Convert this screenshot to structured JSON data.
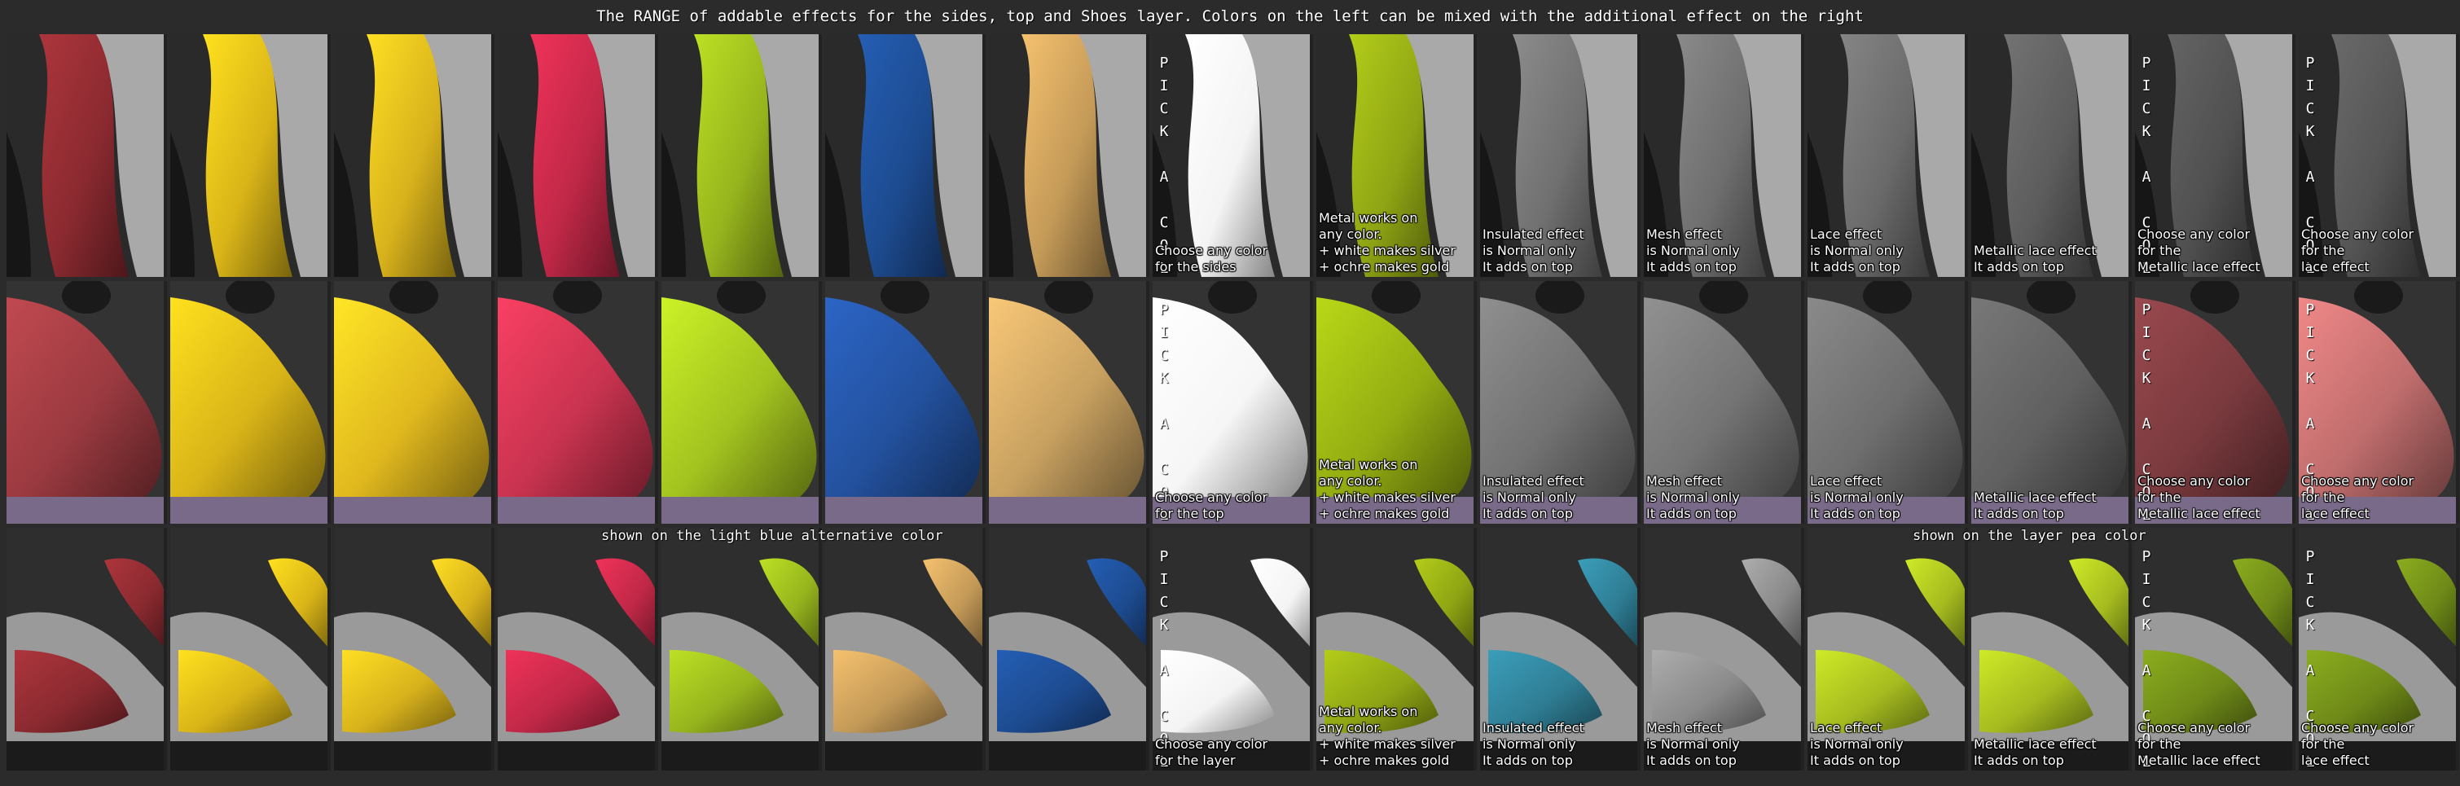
{
  "title": "The RANGE of addable effects for the sides, top and Shoes layer. Colors on the left can be mixed with the additional effect on the right",
  "notes": {
    "shoes_left": "shown on the light blue alternative color",
    "shoes_right": "shown on the layer pea color"
  },
  "pick_label": "P\nI\nC\nK\n \nA\n \nC\nO\nL\nO\nR",
  "palette": {
    "bg": "#2b2b2b",
    "light_blue": "#2f7e95",
    "pea": "#a5bb1f"
  },
  "rows": [
    {
      "id": "sides",
      "cells": [
        {
          "name": "red-lace",
          "fill": "#8a2a30",
          "caption": ""
        },
        {
          "name": "yellow-stripes",
          "fill": "#d9b418",
          "caption": ""
        },
        {
          "name": "yellow",
          "fill": "#d8b21c",
          "caption": ""
        },
        {
          "name": "red",
          "fill": "#c02847",
          "caption": ""
        },
        {
          "name": "green",
          "fill": "#96b41d",
          "caption": ""
        },
        {
          "name": "blue",
          "fill": "#1d4b90",
          "caption": ""
        },
        {
          "name": "ochre",
          "fill": "#c49a58",
          "caption": ""
        },
        {
          "name": "white-pick",
          "fill": "#f4f4f4",
          "caption": "Choose any color\nfor the sides",
          "pick": true
        },
        {
          "name": "metal",
          "fill": "#8fa414",
          "caption": "Metal works on\nany color.\n+ white makes silver\n+ ochre makes gold"
        },
        {
          "name": "insulated",
          "fill": "#707070",
          "caption": "Insulated effect\nis Normal only\nIt adds on top"
        },
        {
          "name": "mesh",
          "fill": "#6e6e6e",
          "caption": "Mesh effect\nis Normal only\nIt adds on top"
        },
        {
          "name": "lace",
          "fill": "#6a6a6a",
          "caption": "Lace effect\nis Normal only\nIt adds on top"
        },
        {
          "name": "metallic-lace",
          "fill": "#5c5c5c",
          "caption": "Metallic lace effect\nIt adds on top"
        },
        {
          "name": "metallic-lace-pick",
          "fill": "#505050",
          "caption": "Choose any color\nfor the\nMetallic lace effect",
          "pick": true
        },
        {
          "name": "lace-pick",
          "fill": "#555555",
          "caption": "Choose any color\nfor the\nlace effect",
          "pick": true
        }
      ]
    },
    {
      "id": "top",
      "cells": [
        {
          "name": "red-lace",
          "fill": "#9a3a40",
          "caption": ""
        },
        {
          "name": "yellow-stripes",
          "fill": "#d9b418",
          "caption": ""
        },
        {
          "name": "yellow",
          "fill": "#e0b81e",
          "caption": ""
        },
        {
          "name": "red",
          "fill": "#c8334f",
          "caption": ""
        },
        {
          "name": "green",
          "fill": "#a2c21f",
          "caption": ""
        },
        {
          "name": "blue",
          "fill": "#23519e",
          "caption": ""
        },
        {
          "name": "ochre",
          "fill": "#c7a060",
          "caption": ""
        },
        {
          "name": "white-pick",
          "fill": "#f6f6f6",
          "caption": "Choose any color\nfor the top",
          "pick": true
        },
        {
          "name": "metal",
          "fill": "#94ad12",
          "caption": "Metal works on\nany color.\n+ white makes silver\n+ ochre makes gold"
        },
        {
          "name": "insulated",
          "fill": "#727272",
          "caption": "Insulated effect\nis Normal only\nIt adds on top"
        },
        {
          "name": "mesh",
          "fill": "#747474",
          "caption": "Mesh effect\nis Normal only\nIt adds on top"
        },
        {
          "name": "lace",
          "fill": "#6e6e6e",
          "caption": "Lace effect\nis Normal only\nIt adds on top"
        },
        {
          "name": "metallic-lace",
          "fill": "#606060",
          "caption": "Metallic lace effect\nIt adds on top"
        },
        {
          "name": "metallic-lace-pick",
          "fill": "#7a3a3e",
          "caption": "Choose any color\nfor the\nMetallic lace effect",
          "pick": true
        },
        {
          "name": "lace-pick",
          "fill": "#c06d6d",
          "caption": "Choose any color\nfor the\nlace effect",
          "pick": true
        }
      ]
    },
    {
      "id": "shoes",
      "cells": [
        {
          "name": "red-lace",
          "fill": "#8a2a30",
          "caption": ""
        },
        {
          "name": "yellow-stripes",
          "fill": "#d9b418",
          "caption": ""
        },
        {
          "name": "yellow",
          "fill": "#d8b21c",
          "caption": ""
        },
        {
          "name": "red",
          "fill": "#c02847",
          "caption": ""
        },
        {
          "name": "green",
          "fill": "#96b41d",
          "caption": ""
        },
        {
          "name": "ochre",
          "fill": "#c49a58",
          "caption": ""
        },
        {
          "name": "blue",
          "fill": "#1d4b90",
          "caption": ""
        },
        {
          "name": "white-pick",
          "fill": "#f4f4f4",
          "caption": "Choose any color\nfor the layer",
          "pick": true
        },
        {
          "name": "metal",
          "fill": "#8fa414",
          "caption": "Metal works on\nany color.\n+ white makes silver\n+ ochre makes gold"
        },
        {
          "name": "insulated",
          "fill": "#2f7e95",
          "caption": "Insulated effect\nis Normal only\nIt adds on top"
        },
        {
          "name": "mesh",
          "fill": "#8a8a8a",
          "caption": "Mesh effect\nis Normal only\nIt adds on top"
        },
        {
          "name": "lace",
          "fill": "#a5bb1f",
          "caption": "Lace effect\nis Normal only\nIt adds on top"
        },
        {
          "name": "metallic-lace",
          "fill": "#a5bb1f",
          "caption": "Metallic lace effect\nIt adds on top"
        },
        {
          "name": "metallic-lace-pick",
          "fill": "#6f8a18",
          "caption": "Choose any color\nfor the\nMetallic lace effect",
          "pick": true
        },
        {
          "name": "lace-pick",
          "fill": "#6f8a18",
          "caption": "Choose any color\nfor the\nlace effect",
          "pick": true
        }
      ]
    }
  ]
}
